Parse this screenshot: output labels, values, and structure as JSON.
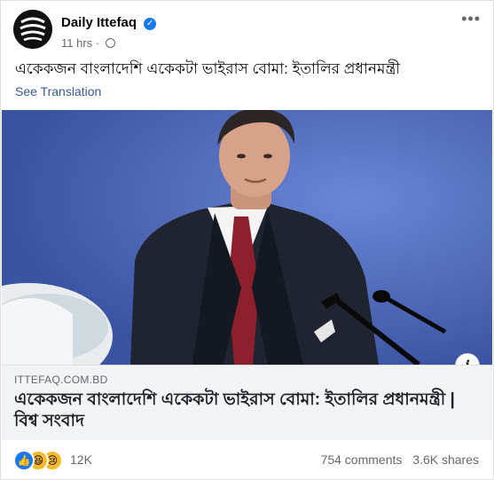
{
  "post": {
    "page_name": "Daily Ittefaq",
    "time": "11 hrs",
    "text": "একেকজন বাংলাদেশি একেকটা ভাইরাস বোমা: ইতালির প্রধানমন্ত্রী",
    "see_translation": "See Translation"
  },
  "link": {
    "domain": "ITTEFAQ.COM.BD",
    "title": "একেকজন বাংলাদেশি একেকটা ভাইরাস বোমা: ইতালির প্রধানমন্ত্রী | বিশ্ব সংবাদ"
  },
  "footer": {
    "reaction_count": "12K",
    "comments": "754 comments",
    "shares": "3.6K shares"
  },
  "icons": [
    "avatar-logo",
    "verified-icon",
    "globe-icon",
    "more-options-icon",
    "info-icon",
    "like-reaction-icon",
    "haha-reaction-icon",
    "sad-reaction-icon"
  ],
  "colors": {
    "verified": "#1877f2",
    "link": "#385898",
    "muted": "#65676b"
  }
}
